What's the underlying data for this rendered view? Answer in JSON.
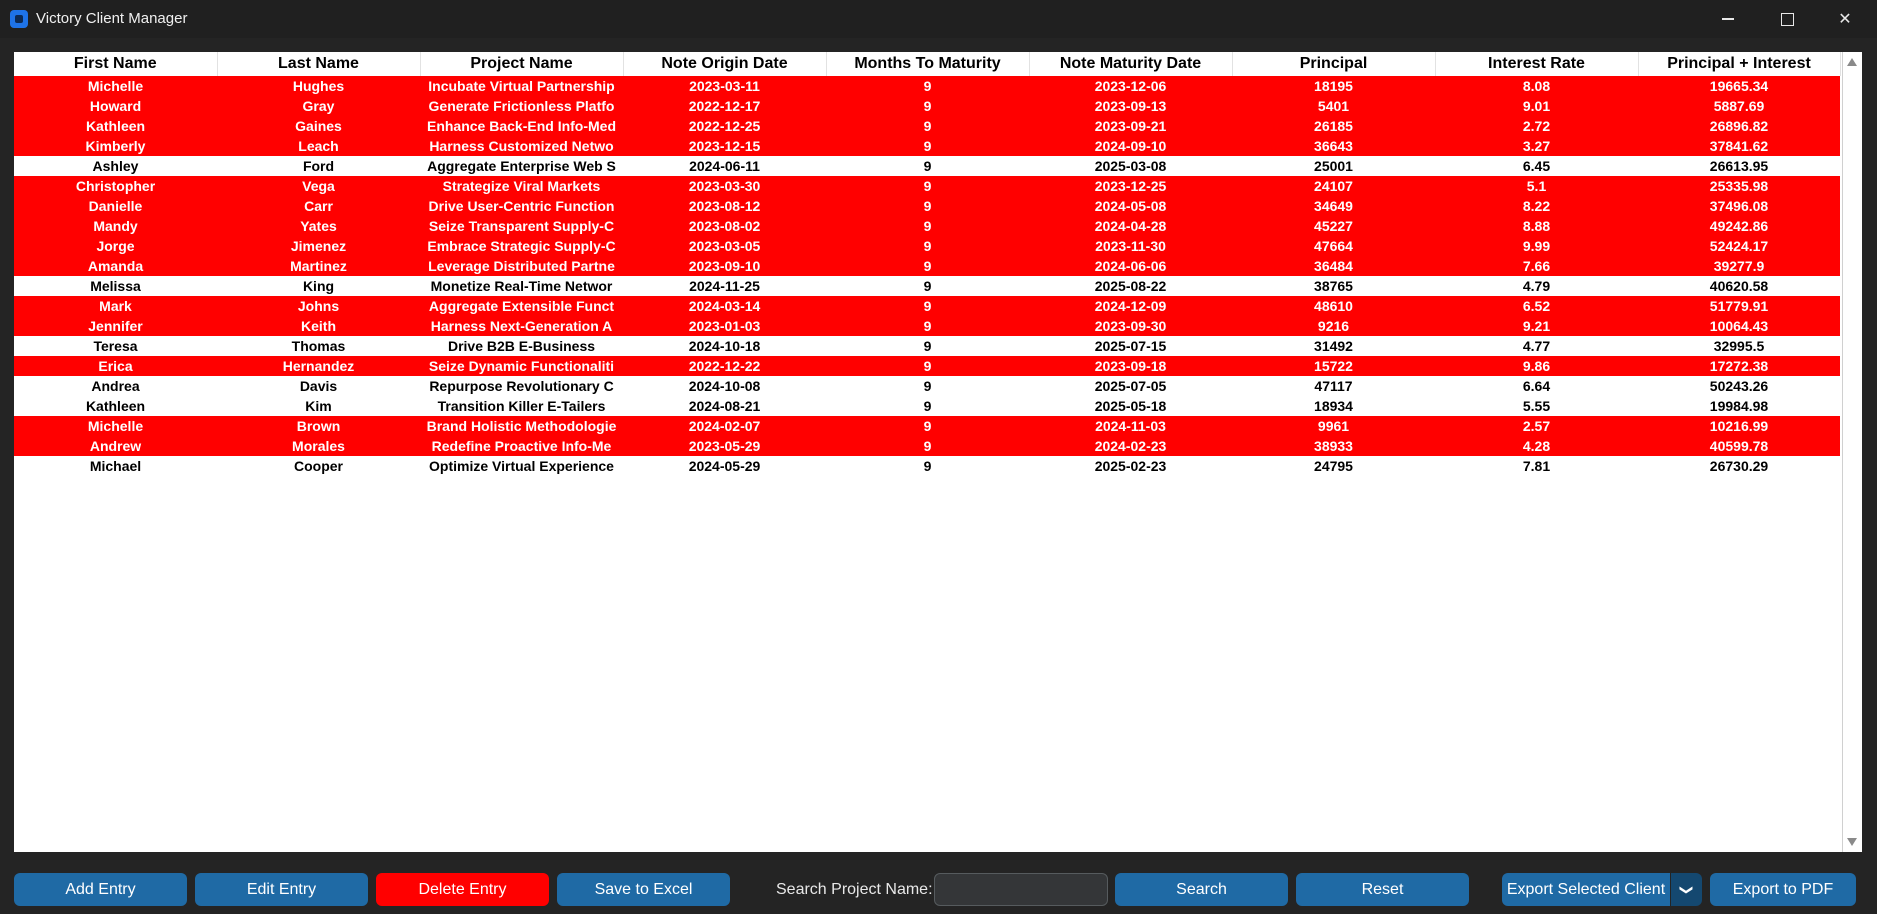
{
  "window": {
    "title": "Victory Client Manager"
  },
  "table": {
    "columns": [
      "First Name",
      "Last Name",
      "Project Name",
      "Note Origin Date",
      "Months To Maturity",
      "Note Maturity Date",
      "Principal",
      "Interest Rate",
      "Principal + Interest"
    ],
    "rows": [
      {
        "highlight": true,
        "cells": [
          "Michelle",
          "Hughes",
          "Incubate Virtual Partnership",
          "2023-03-11",
          "9",
          "2023-12-06",
          "18195",
          "8.08",
          "19665.34"
        ]
      },
      {
        "highlight": true,
        "cells": [
          "Howard",
          "Gray",
          "Generate Frictionless Platfo",
          "2022-12-17",
          "9",
          "2023-09-13",
          "5401",
          "9.01",
          "5887.69"
        ]
      },
      {
        "highlight": true,
        "cells": [
          "Kathleen",
          "Gaines",
          "Enhance Back-End Info-Med",
          "2022-12-25",
          "9",
          "2023-09-21",
          "26185",
          "2.72",
          "26896.82"
        ]
      },
      {
        "highlight": true,
        "cells": [
          "Kimberly",
          "Leach",
          "Harness Customized Netwo",
          "2023-12-15",
          "9",
          "2024-09-10",
          "36643",
          "3.27",
          "37841.62"
        ]
      },
      {
        "highlight": false,
        "cells": [
          "Ashley",
          "Ford",
          "Aggregate Enterprise Web S",
          "2024-06-11",
          "9",
          "2025-03-08",
          "25001",
          "6.45",
          "26613.95"
        ]
      },
      {
        "highlight": true,
        "cells": [
          "Christopher",
          "Vega",
          "Strategize Viral Markets",
          "2023-03-30",
          "9",
          "2023-12-25",
          "24107",
          "5.1",
          "25335.98"
        ]
      },
      {
        "highlight": true,
        "cells": [
          "Danielle",
          "Carr",
          "Drive User-Centric Function",
          "2023-08-12",
          "9",
          "2024-05-08",
          "34649",
          "8.22",
          "37496.08"
        ]
      },
      {
        "highlight": true,
        "cells": [
          "Mandy",
          "Yates",
          "Seize Transparent Supply-C",
          "2023-08-02",
          "9",
          "2024-04-28",
          "45227",
          "8.88",
          "49242.86"
        ]
      },
      {
        "highlight": true,
        "cells": [
          "Jorge",
          "Jimenez",
          "Embrace Strategic Supply-C",
          "2023-03-05",
          "9",
          "2023-11-30",
          "47664",
          "9.99",
          "52424.17"
        ]
      },
      {
        "highlight": true,
        "cells": [
          "Amanda",
          "Martinez",
          "Leverage Distributed Partne",
          "2023-09-10",
          "9",
          "2024-06-06",
          "36484",
          "7.66",
          "39277.9"
        ]
      },
      {
        "highlight": false,
        "cells": [
          "Melissa",
          "King",
          "Monetize Real-Time Networ",
          "2024-11-25",
          "9",
          "2025-08-22",
          "38765",
          "4.79",
          "40620.58"
        ]
      },
      {
        "highlight": true,
        "cells": [
          "Mark",
          "Johns",
          "Aggregate Extensible Funct",
          "2024-03-14",
          "9",
          "2024-12-09",
          "48610",
          "6.52",
          "51779.91"
        ]
      },
      {
        "highlight": true,
        "cells": [
          "Jennifer",
          "Keith",
          "Harness Next-Generation A",
          "2023-01-03",
          "9",
          "2023-09-30",
          "9216",
          "9.21",
          "10064.43"
        ]
      },
      {
        "highlight": false,
        "cells": [
          "Teresa",
          "Thomas",
          "Drive B2B E-Business",
          "2024-10-18",
          "9",
          "2025-07-15",
          "31492",
          "4.77",
          "32995.5"
        ]
      },
      {
        "highlight": true,
        "cells": [
          "Erica",
          "Hernandez",
          "Seize Dynamic Functionaliti",
          "2022-12-22",
          "9",
          "2023-09-18",
          "15722",
          "9.86",
          "17272.38"
        ]
      },
      {
        "highlight": false,
        "cells": [
          "Andrea",
          "Davis",
          "Repurpose Revolutionary C",
          "2024-10-08",
          "9",
          "2025-07-05",
          "47117",
          "6.64",
          "50243.26"
        ]
      },
      {
        "highlight": false,
        "cells": [
          "Kathleen",
          "Kim",
          "Transition Killer E-Tailers",
          "2024-08-21",
          "9",
          "2025-05-18",
          "18934",
          "5.55",
          "19984.98"
        ]
      },
      {
        "highlight": true,
        "cells": [
          "Michelle",
          "Brown",
          "Brand Holistic Methodologie",
          "2024-02-07",
          "9",
          "2024-11-03",
          "9961",
          "2.57",
          "10216.99"
        ]
      },
      {
        "highlight": true,
        "cells": [
          "Andrew",
          "Morales",
          "Redefine Proactive Info-Me",
          "2023-05-29",
          "9",
          "2024-02-23",
          "38933",
          "4.28",
          "40599.78"
        ]
      },
      {
        "highlight": false,
        "cells": [
          "Michael",
          "Cooper",
          "Optimize Virtual Experience",
          "2024-05-29",
          "9",
          "2025-02-23",
          "24795",
          "7.81",
          "26730.29"
        ]
      }
    ]
  },
  "toolbar": {
    "add_label": "Add Entry",
    "edit_label": "Edit Entry",
    "delete_label": "Delete Entry",
    "save_label": "Save to Excel",
    "search_label": "Search Project Name:",
    "search_value": "",
    "search_button_label": "Search",
    "reset_label": "Reset",
    "export_client_label": "Export Selected Client",
    "export_pdf_label": "Export to PDF"
  },
  "colors": {
    "highlight_row": "#ff0000",
    "button": "#1f6aa5",
    "delete_button": "#ff0000",
    "background": "#242424"
  },
  "icons": {
    "app": "app-icon",
    "minimize": "minimize-icon",
    "maximize": "maximize-icon",
    "close": "close-icon",
    "dropdown": "chevron-down-icon"
  }
}
